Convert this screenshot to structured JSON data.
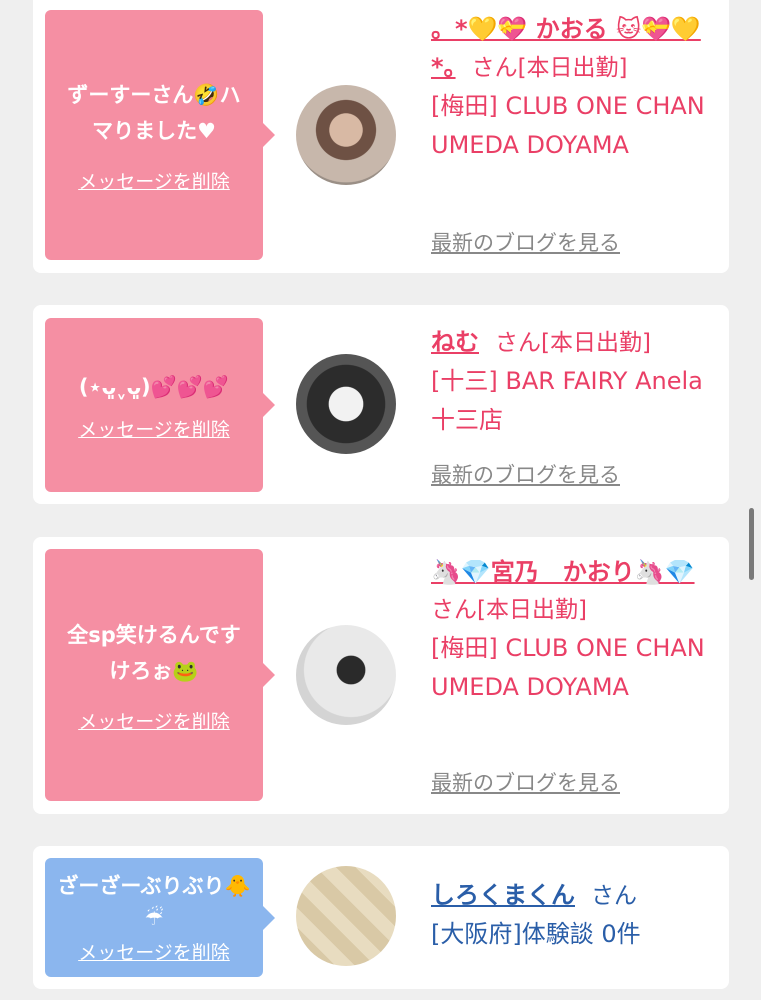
{
  "cards": [
    {
      "message": "ずーすーさん🤣ハマりました♥",
      "delete_label": "メッセージを削除",
      "name": "。*💛💝 かおる 🐱💝💛*。",
      "san": "さん[本日出勤]",
      "shop": "[梅田] CLUB ONE CHAN UMEDA DOYAMA",
      "blog_label": "最新のブログを見る"
    },
    {
      "message": "(⋆ᴗ͈ˬᴗ͈)💕💕💕",
      "delete_label": "メッセージを削除",
      "name": "ねむ",
      "san": "さん[本日出勤]",
      "shop": "[十三] BAR FAIRY Anela 十三店",
      "blog_label": "最新のブログを見る"
    },
    {
      "message": "全sp笑けるんですけろぉ🐸",
      "delete_label": "メッセージを削除",
      "name": "🦄💎宮乃　かおり🦄💎",
      "san": "さん[本日出勤]",
      "shop": "[梅田] CLUB ONE CHAN UMEDA DOYAMA",
      "blog_label": "最新のブログを見る"
    },
    {
      "message": "ざーざーぶりぶり🐥☔",
      "delete_label": "メッセージを削除",
      "name": "しろくまくん",
      "san": "さん",
      "shop": "[大阪府]体験談 0件"
    }
  ],
  "colors": {
    "pink_bubble": "#f58fa3",
    "blue_bubble": "#8bb6ee",
    "pink_text": "#ea3f66",
    "blue_text": "#2a5ea8"
  }
}
